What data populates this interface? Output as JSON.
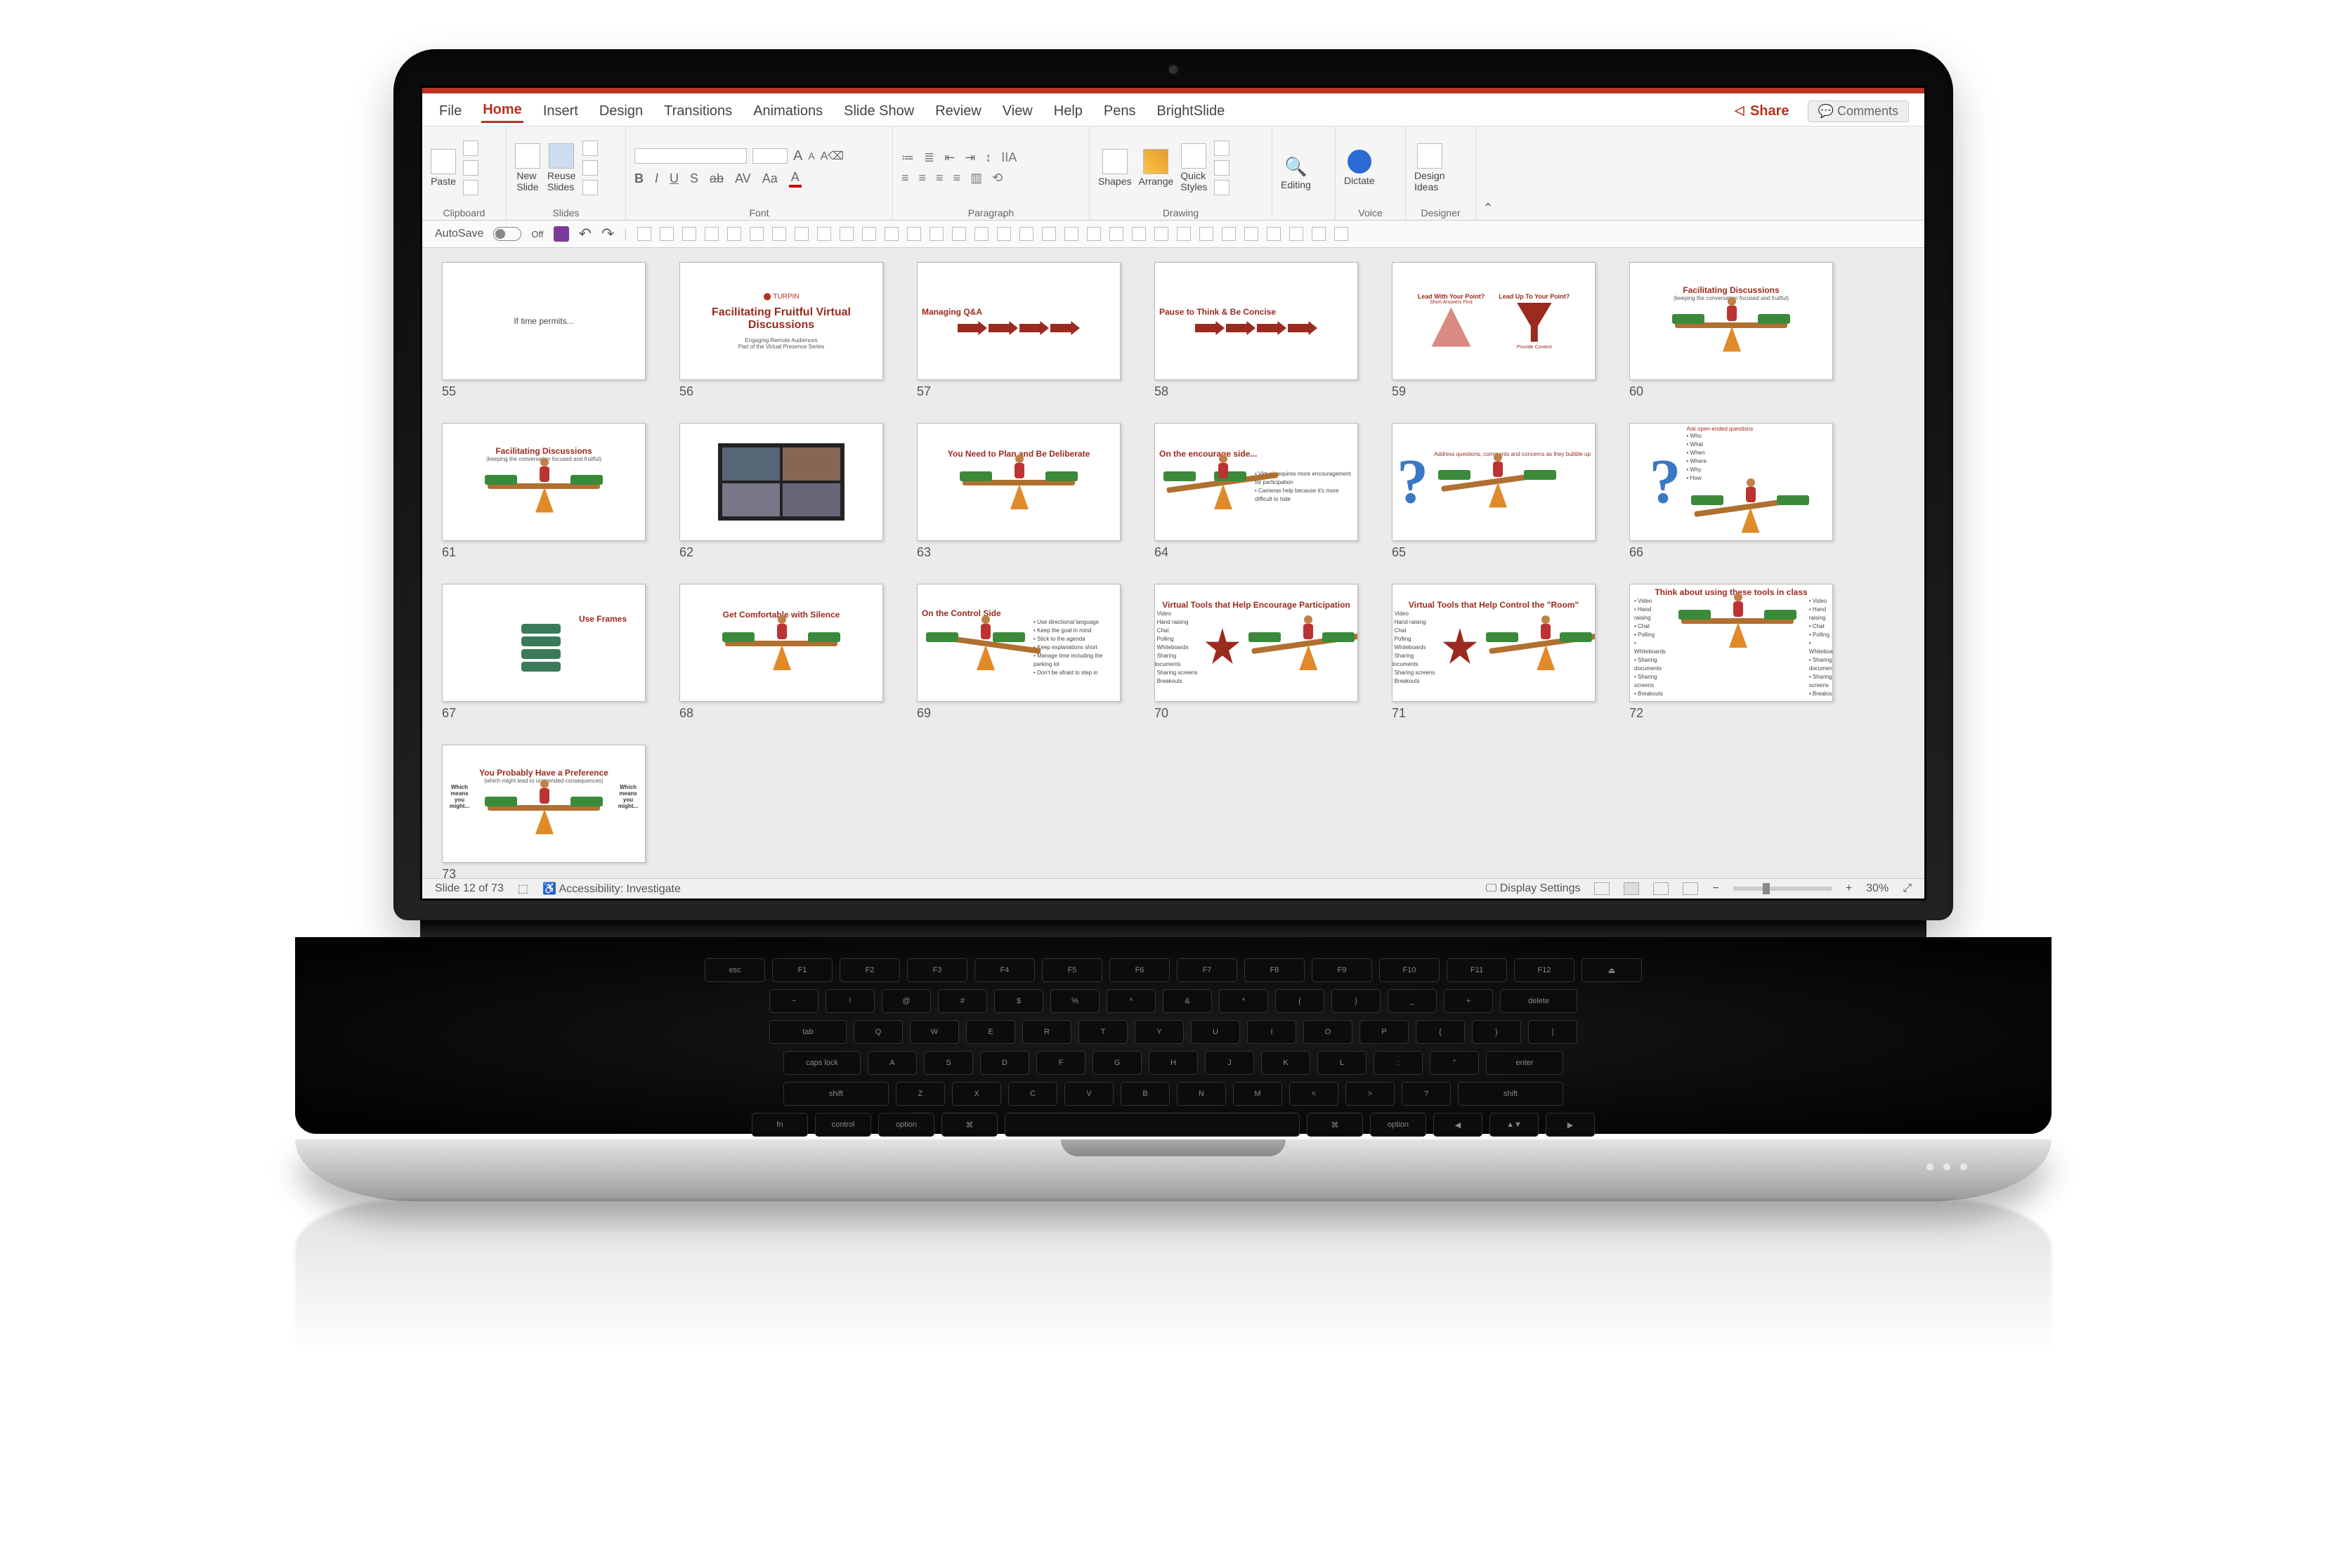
{
  "tabs": {
    "file": "File",
    "home": "Home",
    "insert": "Insert",
    "design": "Design",
    "transitions": "Transitions",
    "animations": "Animations",
    "slideshow": "Slide Show",
    "review": "Review",
    "view": "View",
    "help": "Help",
    "pens": "Pens",
    "brightslide": "BrightSlide"
  },
  "active_tab": "Home",
  "share": "Share",
  "comments": "Comments",
  "ribbon": {
    "clipboard": {
      "label": "Clipboard",
      "paste": "Paste"
    },
    "slides": {
      "label": "Slides",
      "new": "New\nSlide",
      "reuse": "Reuse\nSlides"
    },
    "font": {
      "label": "Font",
      "b": "B",
      "i": "I",
      "u": "U",
      "s": "S",
      "ab": "ab",
      "av": "AV",
      "aa": "Aa",
      "a_big": "A",
      "a_small": "A"
    },
    "paragraph": {
      "label": "Paragraph"
    },
    "drawing": {
      "label": "Drawing",
      "shapes": "Shapes",
      "arrange": "Arrange",
      "quick": "Quick\nStyles"
    },
    "editing": {
      "label": "",
      "editing": "Editing"
    },
    "voice": {
      "label": "Voice",
      "dictate": "Dictate"
    },
    "designer": {
      "label": "Designer",
      "ideas": "Design\nIdeas"
    }
  },
  "qat": {
    "autosave": "AutoSave",
    "off": "Off"
  },
  "status": {
    "slide": "Slide 12 of 73",
    "access": "Accessibility: Investigate",
    "display": "Display Settings",
    "zoom": "30%"
  },
  "slides": [
    {
      "n": 55,
      "type": "text",
      "title": "If time permits..."
    },
    {
      "n": 56,
      "type": "titlecard",
      "logo": "TURPIN",
      "title": "Facilitating Fruitful Virtual Discussions",
      "sub": "Engaging Remote Audiences\nPart of the Virtual Presence Series"
    },
    {
      "n": 57,
      "type": "arrows",
      "title": "Managing Q&A"
    },
    {
      "n": 58,
      "type": "arrows",
      "title": "Pause to Think & Be Concise"
    },
    {
      "n": 59,
      "type": "funneltri",
      "l": "Lead With Your Point?",
      "lsub": "Short Answers First",
      "r": "Lead Up To Your Point?",
      "rsub": "Provide Context"
    },
    {
      "n": 60,
      "type": "balance",
      "title": "Facilitating Discussions",
      "sub": "(keeping the conversation focused and fruitful)"
    },
    {
      "n": 61,
      "type": "balance",
      "title": "Facilitating Discussions",
      "sub": "(keeping the conversation focused and fruitful)"
    },
    {
      "n": 62,
      "type": "video"
    },
    {
      "n": 63,
      "type": "balance",
      "title": "You Need to Plan and Be Deliberate"
    },
    {
      "n": 64,
      "type": "balance_bullets",
      "title": "On the encourage side...",
      "bullets": [
        "Virtual requires more encouragement for participation",
        "Cameras help because it's more difficult to hide"
      ],
      "tilt": true
    },
    {
      "n": 65,
      "type": "q_balance",
      "title": "",
      "caption": "Address questions, comments and concerns as they bubble up"
    },
    {
      "n": 66,
      "type": "q_balance",
      "title": "",
      "caption": "Ask open-ended questions",
      "bullets": [
        "Who",
        "What",
        "When",
        "Where",
        "Why",
        "How"
      ]
    },
    {
      "n": 67,
      "type": "frames",
      "title": "Use Frames"
    },
    {
      "n": 68,
      "type": "balance",
      "title": "Get Comfortable with Silence"
    },
    {
      "n": 69,
      "type": "balance_bullets",
      "title": "On the Control Side",
      "bullets": [
        "Use directional language",
        "Keep the goal in mind",
        "Stick to the agenda",
        "Keep explanations short",
        "Manage time including the parking lot",
        "Don't be afraid to step in"
      ],
      "tilt": true,
      "tiltDir": "r"
    },
    {
      "n": 70,
      "type": "startools",
      "title": "Virtual Tools that Help Encourage Participation",
      "bullets": [
        "Video",
        "Hand raising",
        "Chat",
        "Polling",
        "Whiteboards",
        "Sharing documents",
        "Sharing screens",
        "Breakouts"
      ]
    },
    {
      "n": 71,
      "type": "startools",
      "title": "Virtual Tools that Help Control the \"Room\"",
      "bullets": [
        "Video",
        "Hand raising",
        "Chat",
        "Polling",
        "Whiteboards",
        "Sharing documents",
        "Sharing screens",
        "Breakouts"
      ]
    },
    {
      "n": 72,
      "type": "twocol_tools",
      "title": "Think about using these tools in class",
      "bullets": [
        "Video",
        "Hand raising",
        "Chat",
        "Polling",
        "Whiteboards",
        "Sharing documents",
        "Sharing screens",
        "Breakouts"
      ]
    },
    {
      "n": 73,
      "type": "preference",
      "title": "You Probably Have a Preference",
      "sub": "(which might lead to unintended consequences)",
      "l": "Which means you might...",
      "r": "Which means you might..."
    }
  ],
  "keyboard": {
    "r1": [
      "esc",
      "F1",
      "F2",
      "F3",
      "F4",
      "F5",
      "F6",
      "F7",
      "F8",
      "F9",
      "F10",
      "F11",
      "F12",
      "⏏"
    ],
    "r2": [
      "~",
      "!",
      "@",
      "#",
      "$",
      "%",
      "^",
      "&",
      "*",
      "(",
      ")",
      "_",
      "+",
      "delete"
    ],
    "r3": [
      "tab",
      "Q",
      "W",
      "E",
      "R",
      "T",
      "Y",
      "U",
      "I",
      "O",
      "P",
      "{",
      "}",
      "|"
    ],
    "r4": [
      "caps lock",
      "A",
      "S",
      "D",
      "F",
      "G",
      "H",
      "J",
      "K",
      "L",
      ":",
      "\"",
      "enter"
    ],
    "r5": [
      "shift",
      "Z",
      "X",
      "C",
      "V",
      "B",
      "N",
      "M",
      "<",
      ">",
      "?",
      "shift"
    ],
    "r6": [
      "fn",
      "control",
      "option",
      "⌘",
      "",
      "⌘",
      "option",
      "◀",
      "▲▼",
      "▶"
    ]
  }
}
